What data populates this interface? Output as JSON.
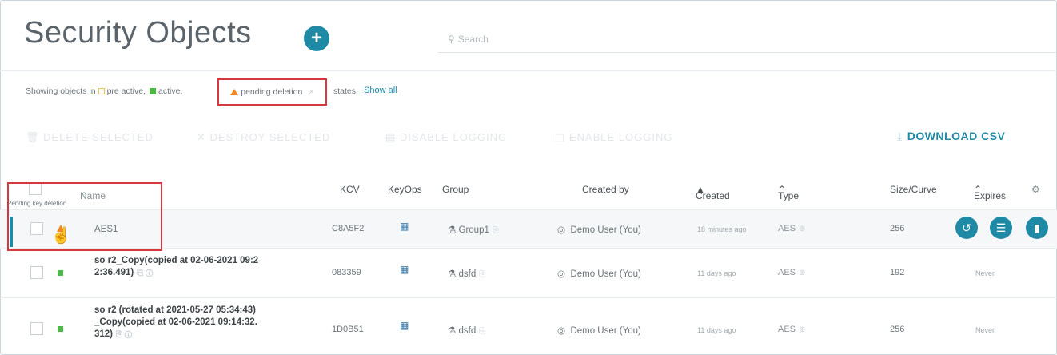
{
  "header": {
    "title": "Security Objects",
    "add_label": "+",
    "search_placeholder": "Search"
  },
  "filters": {
    "showing_text": "Showing objects in",
    "pre_active": "pre active,",
    "active": "active,",
    "pending_deletion": "pending deletion",
    "remove_x": "×",
    "states": "states",
    "show_all": "Show all"
  },
  "actions": {
    "delete_selected": "DELETE SELECTED",
    "destroy_selected": "DESTROY SELECTED",
    "disable_logging": "DISABLE LOGGING",
    "enable_logging": "ENABLE LOGGING",
    "download_csv": "DOWNLOAD CSV"
  },
  "table": {
    "tooltip": "Pending key deletion",
    "columns": {
      "name": "Name",
      "kcv": "KCV",
      "keyops": "KeyOps",
      "group": "Group",
      "created_by": "Created by",
      "created": "Created",
      "type": "Type",
      "size": "Size/Curve",
      "expires": "Expires",
      "settings": "⚙"
    },
    "rows": [
      {
        "name": "AES1",
        "kcv": "C8A5F2",
        "group": "Group1",
        "created_by": "Demo User (You)",
        "created": "18 minutes ago",
        "type": "AES",
        "size": "256",
        "expires": "",
        "status": "pending-deletion"
      },
      {
        "name_line1": "so r2_Copy(copied at 02-06-2021 09:2",
        "name_line2": "2:36.491)",
        "kcv": "083359",
        "group": "dsfd",
        "created_by": "Demo User (You)",
        "created": "11 days ago",
        "type": "AES",
        "size": "192",
        "expires": "Never",
        "status": "active"
      },
      {
        "name_line1": "so r2 (rotated at 2021-05-27 05:34:43)",
        "name_line2": "_Copy(copied at 02-06-2021 09:14:32.",
        "name_line3": "312)",
        "kcv": "1D0B51",
        "group": "dsfd",
        "created_by": "Demo User (You)",
        "created": "11 days ago",
        "type": "AES",
        "size": "256",
        "expires": "Never",
        "status": "active"
      }
    ]
  },
  "colors": {
    "accent": "#1f8aa6",
    "active": "#4cb848",
    "pending": "#f08a20",
    "highlight_border": "#d7373f"
  }
}
